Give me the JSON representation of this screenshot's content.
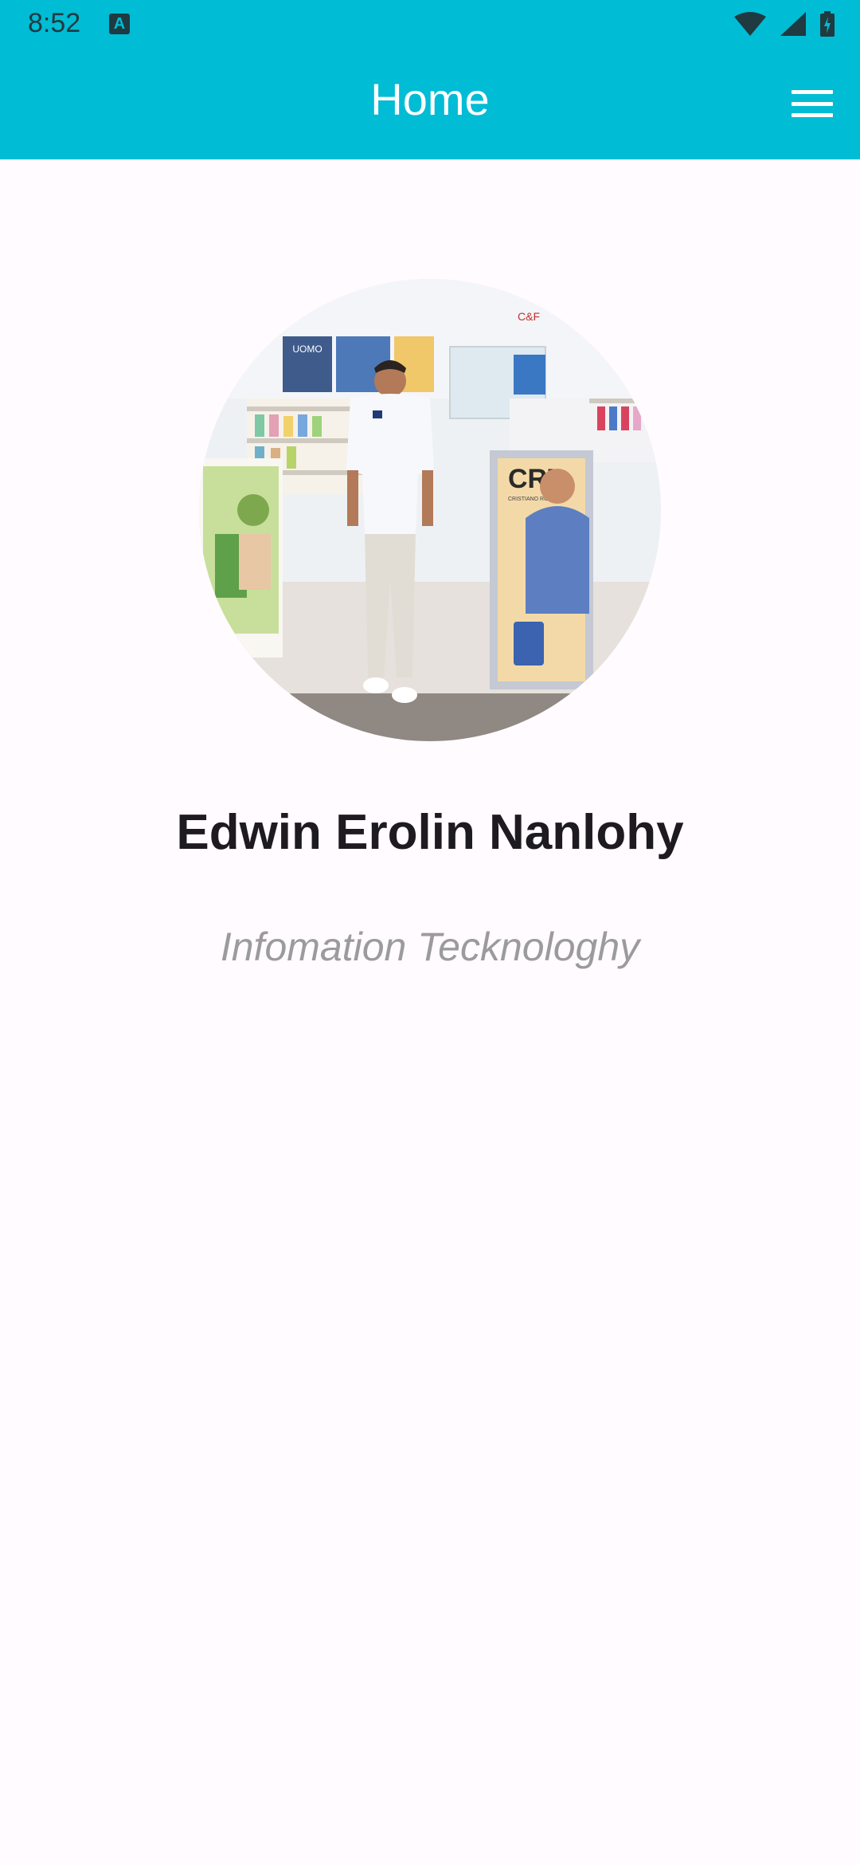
{
  "status_bar": {
    "time": "8:52",
    "app_icon": "A",
    "icons": [
      "wifi-icon",
      "signal-icon",
      "battery-charging-icon"
    ]
  },
  "app_bar": {
    "title": "Home",
    "menu_icon": "hamburger-menu-icon"
  },
  "profile": {
    "name": "Edwin Erolin Nanlohy",
    "subtitle": "Infomation Tecknologhy",
    "photo": {
      "store_sign": "C&F",
      "promo_title": "CR7",
      "promo_sub": "CRISTIANO RONALDO",
      "small_card": "UOMO"
    }
  },
  "colors": {
    "primary": "#00bcd4",
    "background": "#fffbfe",
    "name_text": "#1d1b20",
    "subtitle_text": "#9b9b9b"
  }
}
